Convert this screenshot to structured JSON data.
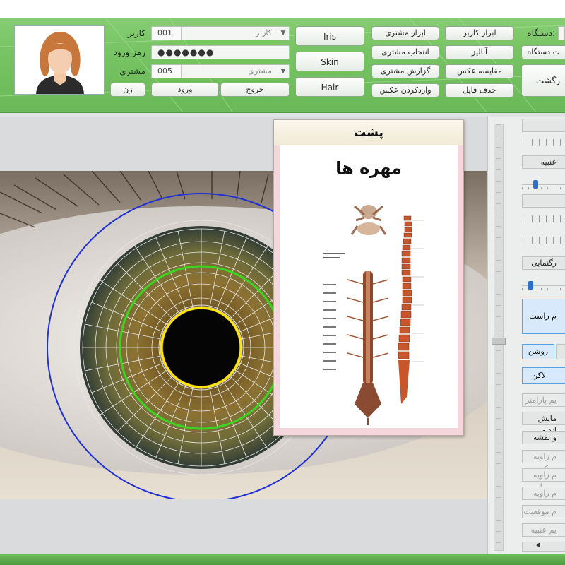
{
  "header": {
    "user_label": "کاربر",
    "password_label": "رمز ورود",
    "customer_label": "مشتری",
    "user_code": "001",
    "user_name": "کاربر",
    "password_value": "●●●●●●●",
    "customer_code": "005",
    "customer_name": "مشتری",
    "gender_button": "زن",
    "exit_button": "خروج",
    "login_button": "ورود",
    "iris_button": "Iris",
    "skin_button": "Skin",
    "hair_button": "Hair",
    "customer_tools": "ابزار مشتری",
    "select_customer": "انتخاب مشتری",
    "customer_report": "گزارش مشتری",
    "import_photo": "واردکردن عکس",
    "user_tools": "ابزار کاربر",
    "analysis": "آنالیز",
    "compare_photo": "مقایسه عکس",
    "delete_file": "حذف فایل",
    "device_label": "دستگاه:",
    "device_settings": "ت دستگاه",
    "back_button": "رگشت"
  },
  "popup": {
    "title": "پشت",
    "subtitle": "مهره ها"
  },
  "right_panel": {
    "btn_1": "",
    "btn_2": "عنبیه",
    "btn_3": "",
    "btn_4": "رگنمایی",
    "btn_right_eye": "م راست",
    "btn_light_prefix": "ی",
    "btn_light": "روشن",
    "btn_stain": "لاکن",
    "btn_param": "یم پارامتر",
    "btn_show_organ": "مایش اندام",
    "btn_map": "و نقشه",
    "btn_center_angle": "م زاویه مرکز",
    "btn_mid_angle": "م زاویه وسط",
    "btn_out_angle": "م زاویه بیرون",
    "btn_position": "م موقعیت",
    "btn_iris": "یم عنبیه",
    "slider_1": 0.25,
    "slider_2": 0.15
  },
  "colors": {
    "header_green": "#78c464",
    "outer_circle": "#1e2fd6",
    "iris_circle": "#3bd421",
    "pupil_circle": "#ffe500"
  }
}
